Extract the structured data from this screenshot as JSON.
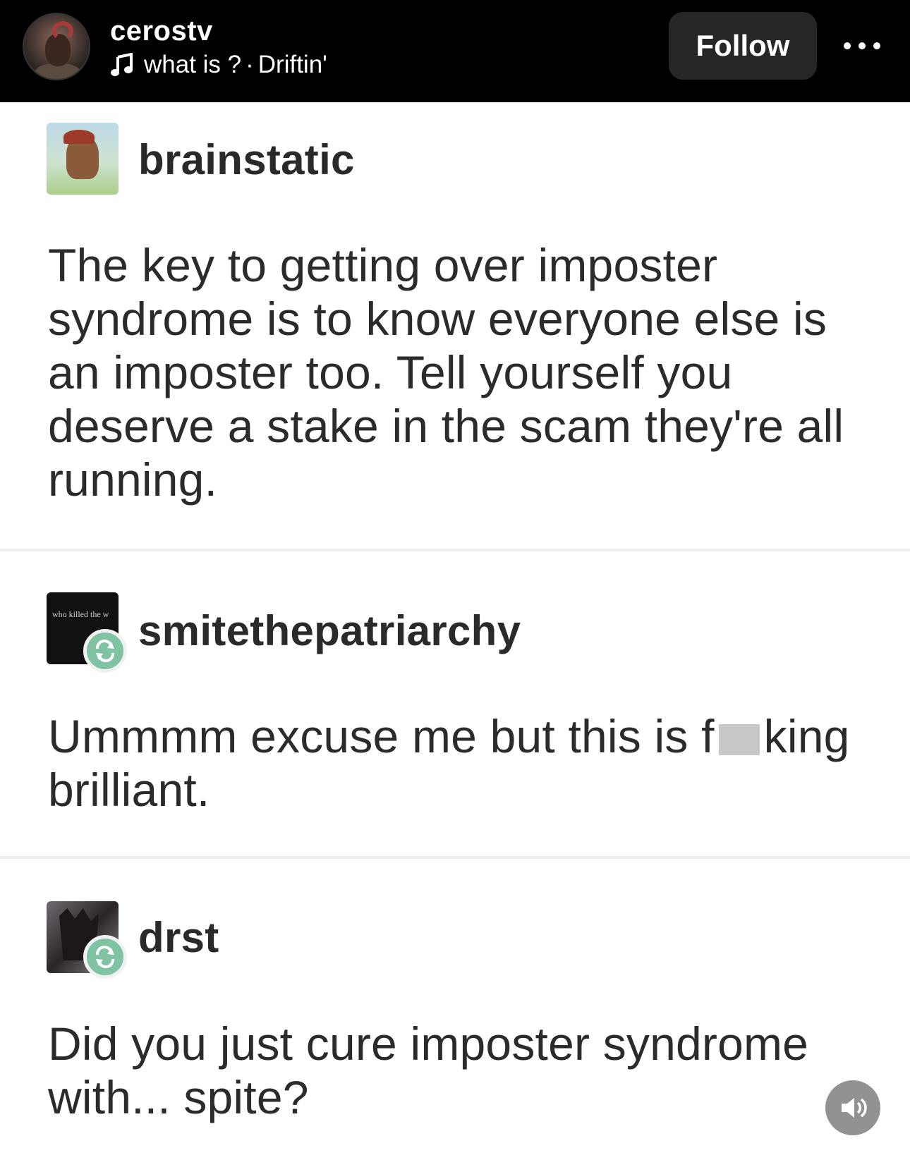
{
  "header": {
    "username": "cerostv",
    "music_song": "what is ?",
    "music_separator": "·",
    "music_artist": "Driftin'",
    "follow_label": "Follow"
  },
  "posts": [
    {
      "handle": "brainstatic",
      "lines": [
        "The key to getting over imposter",
        "syndrome is to know everyone else is",
        "an imposter too. Tell yourself you",
        "deserve a stake in the scam they're all",
        "running."
      ]
    },
    {
      "handle": "smitethepatriarchy",
      "avatar_text": "who killed the w",
      "line1_before": "Ummmm excuse me but this is f",
      "line1_after": "king",
      "line2": "brilliant."
    },
    {
      "handle": "drst",
      "lines": [
        "Did you just cure imposter syndrome",
        "with... spite?"
      ]
    }
  ],
  "colors": {
    "header_bg": "#000000",
    "follow_bg": "#262626",
    "reblog_green": "#7fc3a2",
    "text": "#2b2b2b"
  },
  "icons": {
    "music": "music-note-icon",
    "more": "more-options-icon",
    "sound": "speaker-icon",
    "reblog": "reblog-icon"
  }
}
